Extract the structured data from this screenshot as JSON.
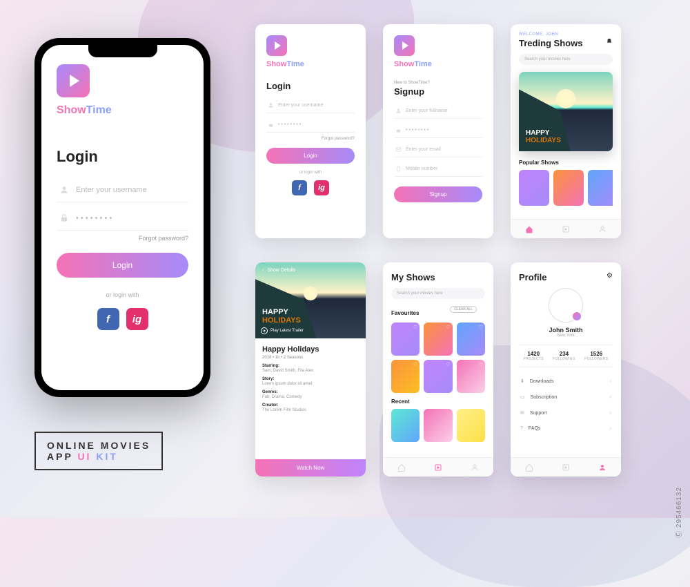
{
  "brand": {
    "part1": "Show",
    "part2": "Time"
  },
  "kit_title": {
    "line1": "ONLINE MOVIES",
    "line2_app": "APP",
    "line2_ui": "UI",
    "line2_kit": "KIT"
  },
  "watermark": "Ⓒ 295466132",
  "login": {
    "title": "Login",
    "username_placeholder": "Enter your username",
    "password_value": "• • • • • • • •",
    "forgot": "Forgot password?",
    "button": "Login",
    "or_login": "or login with",
    "fb": "f",
    "ig": "ig"
  },
  "signup": {
    "subtitle": "New to ShowTime?",
    "title": "Signup",
    "fullname_placeholder": "Enter your fullname",
    "password_value": "• • • • • • • •",
    "email_placeholder": "Enter your email",
    "mobile_placeholder": "Mobile number",
    "button": "Signup"
  },
  "trending": {
    "welcome": "WELCOME, JOHN",
    "title": "Treding Shows",
    "search_placeholder": "Search your movies here",
    "hero_line1": "HAPPY",
    "hero_line2": "HOLIDAYS",
    "popular_label": "Popular Shows"
  },
  "detail": {
    "back": "Show Details",
    "hero_line1": "HAPPY",
    "hero_line2": "HOLIDAYS",
    "play_trailer": "Play Latest Trailer",
    "title": "Happy Holidays",
    "meta": "2018 • 1h • 2 Seasons",
    "starring_label": "Starring:",
    "starring_value": "Sam, David Smith, Fila Alex",
    "story_label": "Story:",
    "story_value": "Lorem ipsum dolor sit amet",
    "genres_label": "Genres:",
    "genres_value": "Fab, Drama, Comedy",
    "creator_label": "Creator:",
    "creator_value": "The Lorem Film Studios",
    "watch_button": "Watch Now"
  },
  "myshows": {
    "title": "My Shows",
    "search_placeholder": "Search your movies here",
    "favourites_label": "Favourites",
    "clear_all": "CLEAR ALL",
    "recent_label": "Recent"
  },
  "profile": {
    "title": "Profile",
    "name": "John Smith",
    "location": "New York",
    "stats": [
      {
        "n": "1420",
        "l": "PROJECTS"
      },
      {
        "n": "234",
        "l": "FOLLOWING"
      },
      {
        "n": "1526",
        "l": "FOLLOWERS"
      }
    ],
    "menu": [
      {
        "icon": "⬇",
        "label": "Downloads"
      },
      {
        "icon": "▭",
        "label": "Subscription"
      },
      {
        "icon": "✉",
        "label": "Support"
      },
      {
        "icon": "?",
        "label": "FAQs"
      }
    ]
  }
}
